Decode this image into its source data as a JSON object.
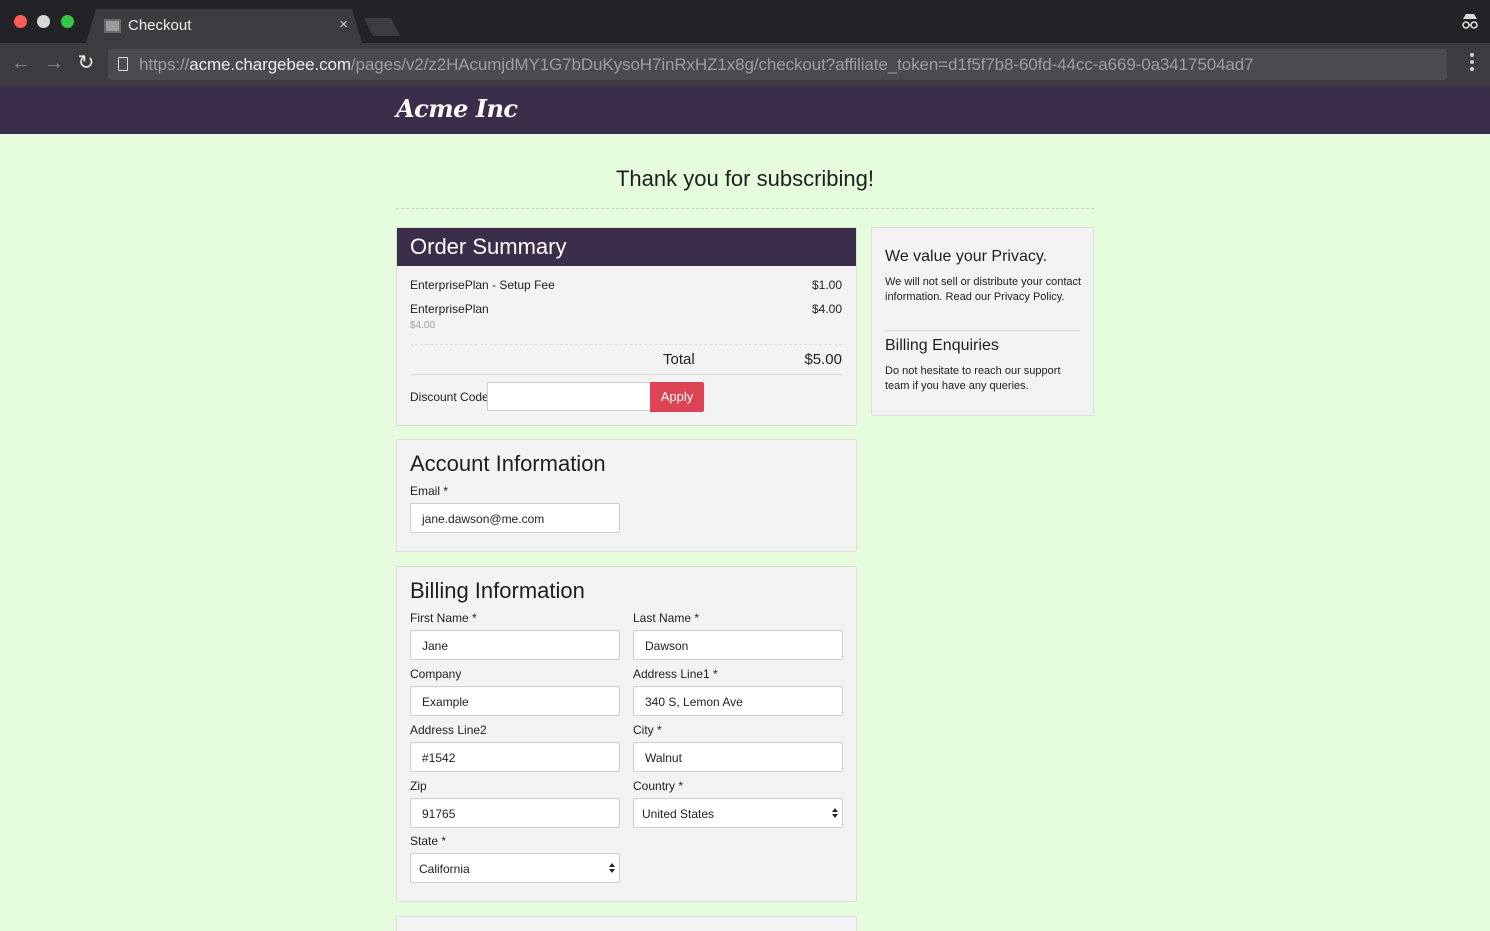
{
  "browser": {
    "tab_title": "Checkout",
    "tab_close": "×",
    "url_scheme": "https://",
    "url_host": "acme.chargebee.com",
    "url_path": "/pages/v2/z2HAcumjdMY1G7bDuKysoH7inRxHZ1x8g/checkout?affiliate_token=d1f5f7b8-60fd-44cc-a669-0a3417504ad7",
    "back_glyph": "←",
    "forward_glyph": "→",
    "reload_glyph": "↻",
    "icons": [
      "back-arrow-icon",
      "forward-arrow-icon",
      "reload-icon",
      "page-icon",
      "incognito-icon",
      "menu-dots-icon"
    ]
  },
  "site": {
    "logo": "Acme Inc",
    "colors": {
      "header": "#3a2e4b",
      "background": "#e5fcdd",
      "apply_button": "#dc4456"
    }
  },
  "page": {
    "heading": "Thank you for subscribing!"
  },
  "order_summary": {
    "title": "Order Summary",
    "items": [
      {
        "name": "EnterprisePlan - Setup Fee",
        "price": "$1.00",
        "sub": ""
      },
      {
        "name": "EnterprisePlan",
        "price": "$4.00",
        "sub": "$4.00"
      }
    ],
    "total_label": "Total",
    "total_value": "$5.00",
    "discount_label": "Discount Code",
    "discount_value": "",
    "apply_label": "Apply"
  },
  "account": {
    "title": "Account Information",
    "email_label": "Email *",
    "email_value": "jane.dawson@me.com"
  },
  "billing": {
    "title": "Billing Information",
    "first_name_label": "First Name *",
    "first_name_value": "Jane",
    "last_name_label": "Last Name *",
    "last_name_value": "Dawson",
    "company_label": "Company",
    "company_value": "Example",
    "address1_label": "Address Line1 *",
    "address1_value": "340 S, Lemon Ave",
    "address2_label": "Address Line2",
    "address2_value": "#1542",
    "city_label": "City *",
    "city_value": "Walnut",
    "zip_label": "Zip",
    "zip_value": "91765",
    "country_label": "Country *",
    "country_value": "United States",
    "state_label": "State *",
    "state_value": "California"
  },
  "sidebar": {
    "privacy_title": "We value your Privacy.",
    "privacy_text": "We will not sell or distribute your contact information. Read our Privacy Policy.",
    "enquiries_title": "Billing Enquiries",
    "enquiries_text": "Do not hesitate to reach our support team if you have any queries."
  }
}
